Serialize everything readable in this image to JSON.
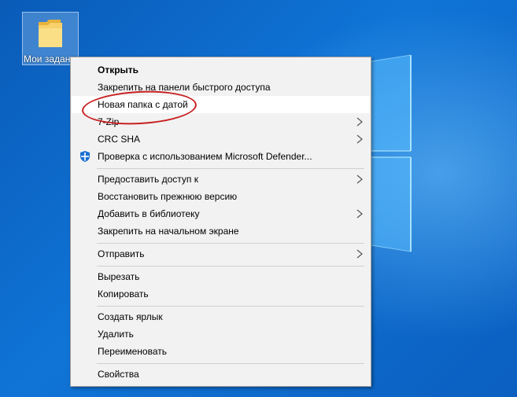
{
  "desktop": {
    "icon_label": "Мои задания",
    "icon_name": "folder-icon",
    "background_color": "#0f74d6"
  },
  "menu": {
    "items": [
      {
        "label": "Открыть",
        "bold": true
      },
      {
        "label": "Закрепить на панели быстрого доступа"
      },
      {
        "label": "Новая папка с датой",
        "highlighted": true,
        "annotation": "red-ellipse"
      },
      {
        "label": "7-Zip",
        "submenu": true
      },
      {
        "label": "CRC SHA",
        "submenu": true
      },
      {
        "label": "Проверка с использованием Microsoft Defender...",
        "icon": "defender-shield-icon"
      },
      {
        "label": "Предоставить доступ к",
        "submenu": true
      },
      {
        "label": "Восстановить прежнюю версию"
      },
      {
        "label": "Добавить в библиотеку",
        "submenu": true
      },
      {
        "label": "Закрепить на начальном экране"
      },
      {
        "label": "Отправить",
        "submenu": true
      },
      {
        "label": "Вырезать"
      },
      {
        "label": "Копировать"
      },
      {
        "label": "Создать ярлык"
      },
      {
        "label": "Удалить"
      },
      {
        "label": "Переименовать"
      },
      {
        "label": "Свойства"
      }
    ]
  },
  "colors": {
    "highlight": "#ffffff",
    "annotation": "#c82020",
    "defender_blue": "#1a6fd1"
  }
}
